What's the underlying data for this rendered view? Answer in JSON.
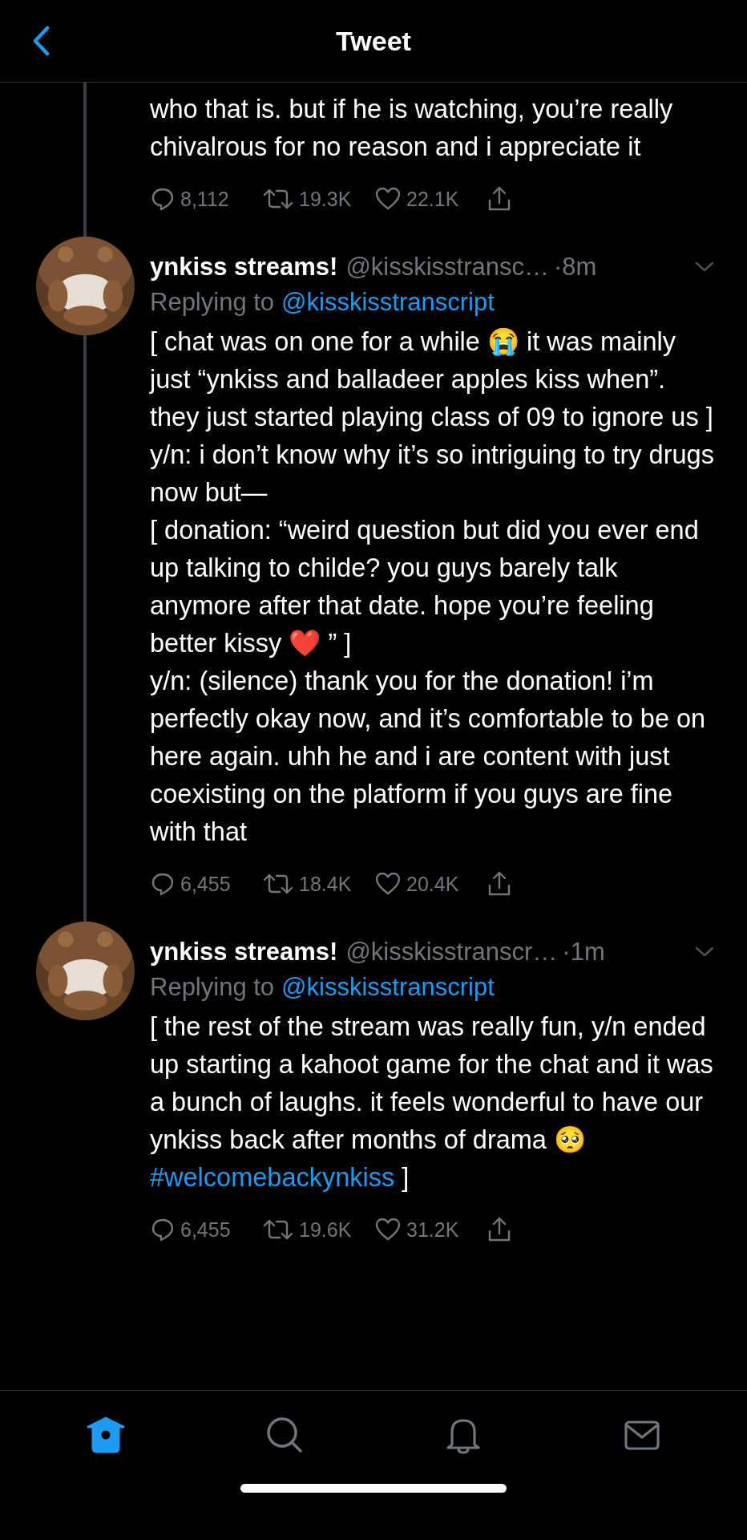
{
  "header": {
    "title": "Tweet"
  },
  "tweets": [
    {
      "body": [
        [
          {
            "kind": "text",
            "text": "who that is. but if he is watching, you’re really chivalrous for no reason and i appreciate it"
          }
        ]
      ],
      "stats": {
        "replies": "8,112",
        "retweets": "19.3K",
        "likes": "22.1K"
      }
    },
    {
      "avatar": {
        "kind": "picture"
      },
      "name": "ynkiss streams!",
      "handle": "@kisskisstransc…",
      "time": "·8m",
      "replying_to": {
        "label": "Replying to",
        "handle": "@kisskisstranscript"
      },
      "body": [
        [
          {
            "kind": "text",
            "text": "[ chat was on one for a while 😭 it was mainly just “ynkiss and balladeer apples kiss when”. they just started playing class of 09 to ignore us ]"
          }
        ],
        [
          {
            "kind": "text",
            "text": "y/n: i don’t know why it’s so intriguing to try drugs now but—"
          }
        ],
        [
          {
            "kind": "text",
            "text": "[ donation: “weird question but did you ever end up talking to childe? you guys barely talk anymore after that date. hope you’re feeling better kissy ❤️ ” ]"
          }
        ],
        [
          {
            "kind": "text",
            "text": "y/n: (silence) thank you for the donation! i’m perfectly okay now, and it’s comfortable to be on here again. uhh he and i are content with just coexisting on the platform if you guys are fine with that"
          }
        ]
      ],
      "stats": {
        "replies": "6,455",
        "retweets": "18.4K",
        "likes": "20.4K"
      }
    },
    {
      "avatar": {
        "kind": "picture"
      },
      "name": "ynkiss streams!",
      "handle": "@kisskisstranscr…",
      "time": "·1m",
      "replying_to": {
        "label": "Replying to",
        "handle": "@kisskisstranscript"
      },
      "body": [
        [
          {
            "kind": "text",
            "text": "[ the rest of the stream was really fun, y/n ended up starting a kahoot game for the chat and it was a bunch of laughs. it feels wonderful to have our ynkiss back after months of drama 🥺"
          }
        ],
        [
          {
            "kind": "link",
            "text": "#welcomebackynkiss"
          },
          {
            "kind": "text",
            "text": " ]"
          }
        ]
      ],
      "stats": {
        "replies": "6,455",
        "retweets": "19.6K",
        "likes": "31.2K"
      }
    }
  ],
  "tab_bar": [
    {
      "kind": "home",
      "selected": true
    },
    {
      "kind": "search",
      "selected": false
    },
    {
      "kind": "notifications",
      "selected": false
    },
    {
      "kind": "messages",
      "selected": false
    }
  ]
}
